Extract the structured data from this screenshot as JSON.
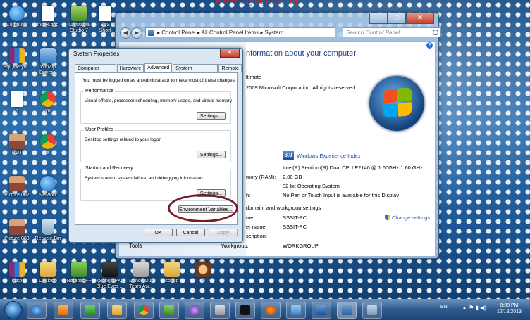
{
  "watermark": "www.mysql.net.in",
  "desktop": {
    "icons": [
      {
        "label": "Computer",
        "type": "globe"
      },
      {
        "label": "index.php",
        "type": "doc"
      },
      {
        "label": "Camtasia Studio 7",
        "type": "cam"
      },
      {
        "label": "STS Short",
        "type": "doc"
      },
      {
        "label": "SqlQuery8...",
        "type": "rar"
      },
      {
        "label": "WinZip Driver...",
        "type": "zip"
      },
      {
        "label": "n",
        "type": "doc"
      },
      {
        "label": "vo",
        "type": "chrome"
      },
      {
        "label": "NOT",
        "type": "person"
      },
      {
        "label": "a",
        "type": "chrome"
      },
      {
        "label": "Picture 002",
        "type": "person"
      },
      {
        "label": "Network",
        "type": "globe"
      },
      {
        "label": "Picture 003",
        "type": "person"
      },
      {
        "label": "Recycle Bin",
        "type": "bin"
      },
      {
        "label": "sssp",
        "type": "rar"
      },
      {
        "label": "Desktop",
        "type": "folder"
      },
      {
        "label": "Notepad++",
        "type": "note"
      },
      {
        "label": "(Songs.PK) Blue Eyes ...",
        "type": "media"
      },
      {
        "label": "Dance Our Tears Aw...",
        "type": "dance"
      },
      {
        "label": "spring",
        "type": "folder"
      },
      {
        "label": "1",
        "type": "face"
      }
    ]
  },
  "control_panel": {
    "breadcrumb": "▸ Control Panel ▸ All Control Panel Items ▸ System",
    "search_placeholder": "Search Control Panel",
    "heading": "nformation about your computer",
    "edition_line": "ltimate",
    "copyright": "2009 Microsoft Corporation.  All rights reserved.",
    "wei_score": "3.0",
    "wei_link": "Windows Experience Index",
    "processor": "Intel(R) Pentium(R) Dual  CPU  E2140  @ 1.60GHz   1.60 GHz",
    "memory_label": "mory (RAM):",
    "memory_value": "2.00 GB",
    "system_type": "32-bit Operating System",
    "pen_label": "h:",
    "pen_value": "No Pen or Touch Input is available for this Display",
    "domain_heading": "domain, and workgroup settings",
    "computer_name_label": "me:",
    "computer_name": "SSSIT-PC",
    "full_name_label": "er name:",
    "full_name": "SSSIT-PC",
    "desc_label": "scription:",
    "workgroup_label": "Workgroup:",
    "workgroup": "WORKGROUP",
    "change_settings": "Change settings",
    "tools_label": "Tools",
    "help": "?"
  },
  "system_properties": {
    "title": "System Properties",
    "tabs": [
      "Computer Name",
      "Hardware",
      "Advanced",
      "System Protection",
      "Remote"
    ],
    "admin_note": "You must be logged on as an Administrator to make most of these changes.",
    "performance_label": "Performance",
    "performance_desc": "Visual effects, processor scheduling, memory usage, and virtual memory",
    "user_profiles_label": "User Profiles",
    "user_profiles_desc": "Desktop settings related to your logon",
    "startup_label": "Startup and Recovery",
    "startup_desc": "System startup, system failure, and debugging information",
    "settings_label": "Settings...",
    "env_vars_label": "Environment Variables...",
    "ok_label": "OK",
    "cancel_label": "Cancel",
    "apply_label": "Apply"
  },
  "taskbar": {
    "language": "EN",
    "time": "8:08 PM",
    "date": "12/18/2013"
  }
}
